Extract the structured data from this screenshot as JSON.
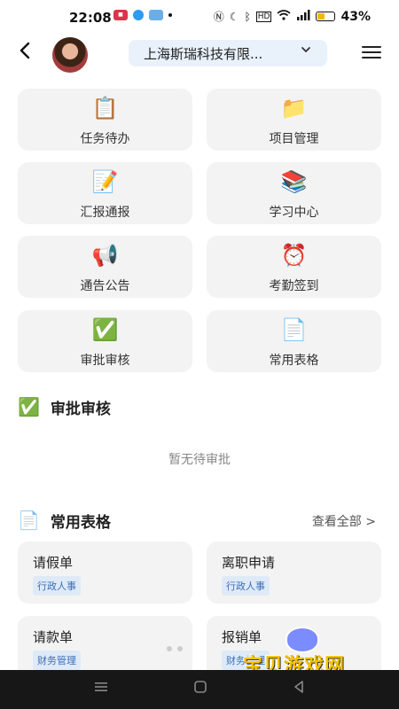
{
  "status_bar": {
    "time": "22:08",
    "battery_percent": "43%",
    "battery_level": 0.43,
    "left_icons": [
      "app-notification-icon",
      "cloud-app-icon",
      "weather-app-icon",
      "dot-icon"
    ],
    "right_icons": [
      "nfc-icon",
      "moon-icon",
      "bluetooth-icon",
      "hd-icon",
      "wifi-icon",
      "signal-icon",
      "battery-icon"
    ]
  },
  "header": {
    "company": "上海斯瑞科技有限..."
  },
  "tiles": [
    {
      "label": "任务待办",
      "icon": "📋",
      "icon_name": "clipboard-icon"
    },
    {
      "label": "项目管理",
      "icon": "📁",
      "icon_name": "folder-icon"
    },
    {
      "label": "汇报通报",
      "icon": "📝",
      "icon_name": "memo-icon"
    },
    {
      "label": "学习中心",
      "icon": "📚",
      "icon_name": "books-icon"
    },
    {
      "label": "通告公告",
      "icon": "📢",
      "icon_name": "megaphone-icon"
    },
    {
      "label": "考勤签到",
      "icon": "⏰",
      "icon_name": "alarm-clock-icon"
    },
    {
      "label": "审批审核",
      "icon": "✅",
      "icon_name": "check-mark-icon"
    },
    {
      "label": "常用表格",
      "icon": "📄",
      "icon_name": "document-icon"
    }
  ],
  "approval": {
    "title": "审批审核",
    "icon": "✅",
    "empty_text": "暂无待审批"
  },
  "forms": {
    "title": "常用表格",
    "icon": "📄",
    "view_all": "查看全部 >",
    "items": [
      {
        "title": "请假单",
        "tag": "行政人事"
      },
      {
        "title": "离职申请",
        "tag": "行政人事"
      },
      {
        "title": "请款单",
        "tag": "财务管理"
      },
      {
        "title": "报销单",
        "tag": "财务管理"
      }
    ]
  },
  "watermark": {
    "text": "宝贝游戏网",
    "url": "baobeiy.com"
  },
  "colors": {
    "accent_bg": "#e9f1fb",
    "tag_bg": "#dfeaf8",
    "tag_text": "#3b6fb6",
    "tile_bg": "#f3f3f3",
    "battery": "#f3b800"
  }
}
